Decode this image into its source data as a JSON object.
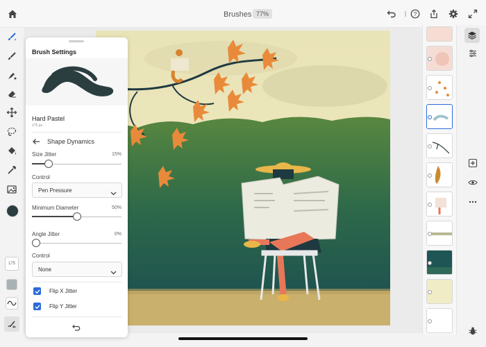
{
  "header": {
    "doc_title": "Brushes",
    "zoom": "77%"
  },
  "left_tools": [
    "pixel-brush-icon",
    "live-brush-icon",
    "vector-brush-icon",
    "eraser-icon",
    "move-icon",
    "lasso-icon",
    "fill-icon",
    "eyedropper-icon",
    "image-icon"
  ],
  "brush_bar": {
    "size_label": "175",
    "color": "#2b3e3f"
  },
  "panel": {
    "title": "Brush Settings",
    "brush_name": "Hard Pastel",
    "brush_size": "175 px",
    "section": "Shape Dynamics",
    "size_jitter": {
      "label": "Size Jitter",
      "value_text": "15%",
      "value": 0.15
    },
    "control1": {
      "label": "Control",
      "selected": "Pen Pressure"
    },
    "min_diameter": {
      "label": "Minimum Diameter",
      "value_text": "50%",
      "value": 0.5
    },
    "angle_jitter": {
      "label": "Angle Jitter",
      "value_text": "0%",
      "value": 0.0
    },
    "control2": {
      "label": "Control",
      "selected": "None"
    },
    "flip_x": {
      "label": "Flip X Jitter",
      "checked": true
    },
    "flip_y": {
      "label": "Flip Y Jitter",
      "checked": true
    }
  },
  "colors": {
    "accent": "#2a6bd9",
    "panel_bg": "#ffffff",
    "brush_stroke": "#2b3e3f"
  }
}
